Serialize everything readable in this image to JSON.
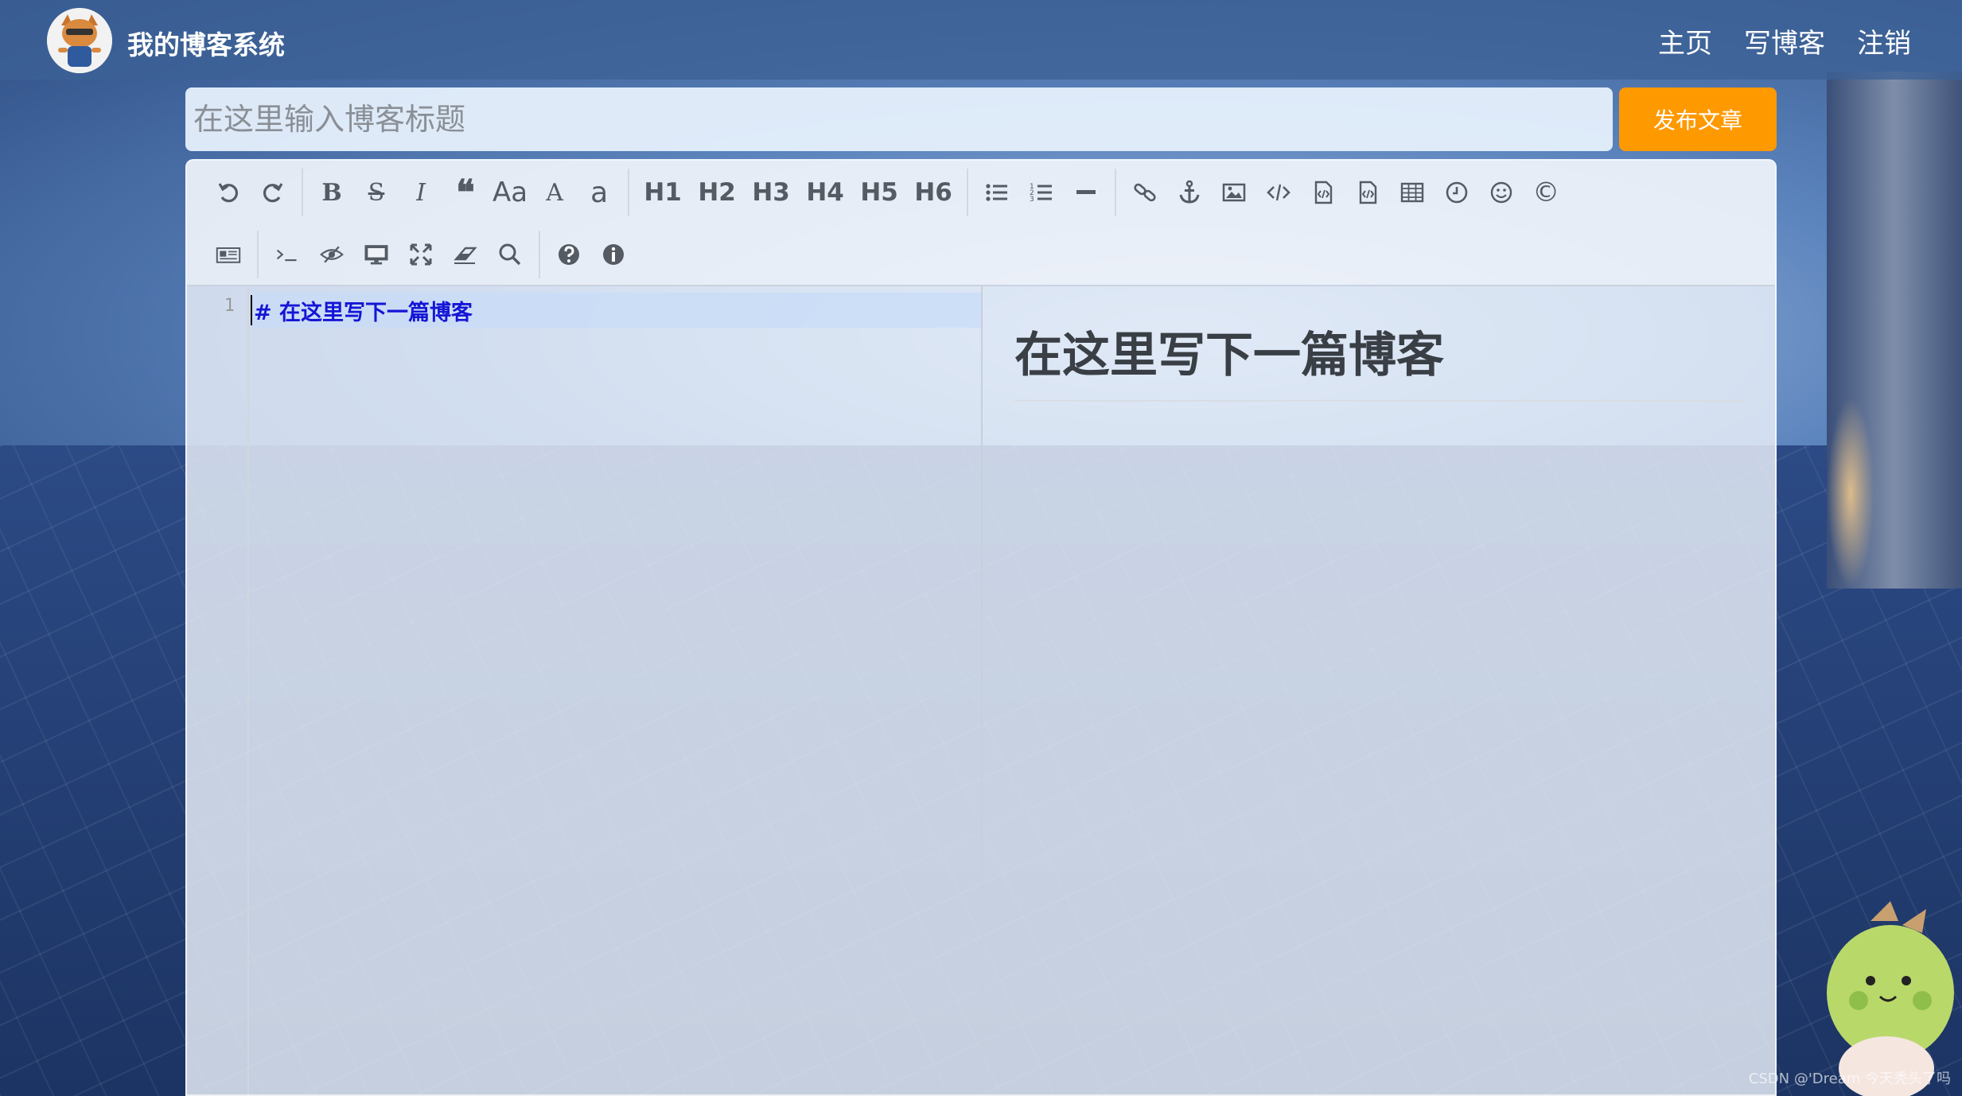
{
  "header": {
    "brand": "我的博客系统",
    "nav": [
      "主页",
      "写博客",
      "注销"
    ]
  },
  "title_bar": {
    "placeholder": "在这里输入博客标题",
    "publish_label": "发布文章"
  },
  "toolbar": {
    "row1": {
      "bold": "B",
      "strike": "S",
      "italic": "I",
      "quote": "❝",
      "case_upper": "Aa",
      "case_a": "A",
      "case_lower": "a",
      "h1": "H1",
      "h2": "H2",
      "h3": "H3",
      "h4": "H4",
      "h5": "H5",
      "h6": "H6",
      "copyright": "©"
    }
  },
  "editor": {
    "line_number": "1",
    "code_text": "# 在这里写下一篇博客"
  },
  "preview": {
    "heading": "在这里写下一篇博客"
  },
  "watermark": "CSDN @'Dream 今天秃头了吗",
  "colors": {
    "accent": "#ff9900",
    "navbar": "#3c6296",
    "code_heading": "#1515d6"
  }
}
